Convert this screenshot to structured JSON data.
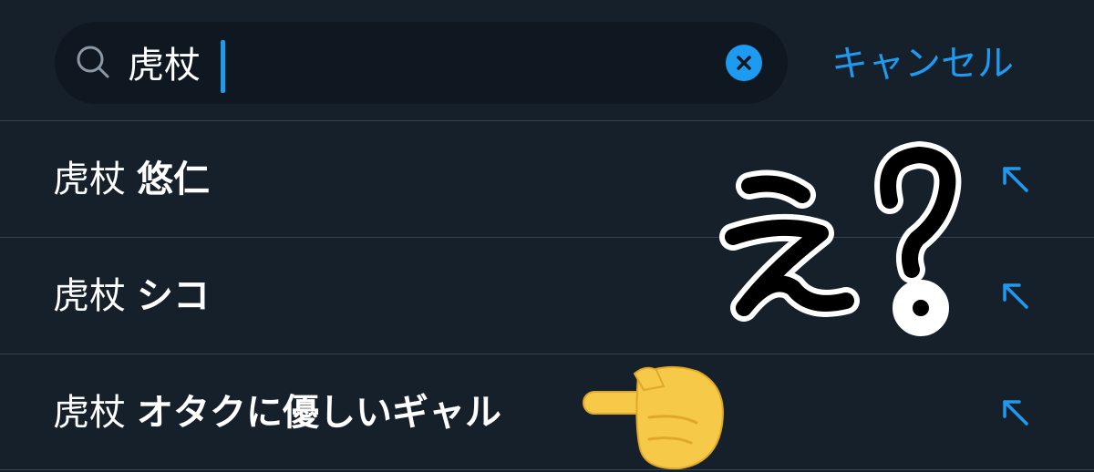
{
  "search": {
    "query": "虎杖",
    "cancel_label": "キャンセル"
  },
  "suggestions": [
    {
      "query": "虎杖",
      "completion": "悠仁"
    },
    {
      "query": "虎杖",
      "completion": "シコ"
    },
    {
      "query": "虎杖",
      "completion": "オタクに優しいギャル"
    }
  ],
  "overlay": {
    "sticker_text": "え？",
    "pointer_emoji": "pointing-right-hand"
  },
  "colors": {
    "background": "#15202b",
    "search_box": "#0f1821",
    "accent": "#1d9bf0",
    "divider": "#38444d",
    "hand": "#f7c948"
  }
}
